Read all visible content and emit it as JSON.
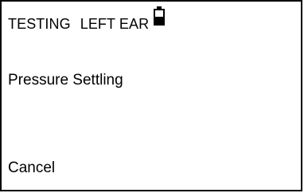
{
  "status": {
    "mode": "TESTING",
    "ear": "LEFT EAR",
    "battery_icon": "battery-half-icon",
    "battery_level": 0.5
  },
  "message": "Pressure Settling",
  "actions": {
    "cancel_label": "Cancel"
  }
}
